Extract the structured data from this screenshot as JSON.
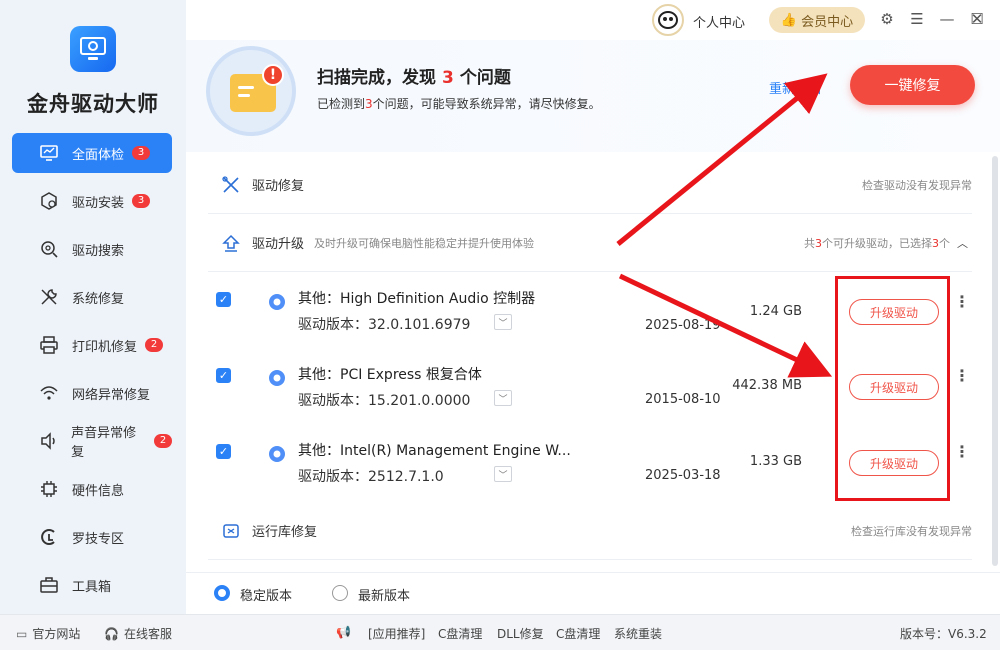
{
  "app": {
    "name": "金舟驱动大师"
  },
  "sidebar": {
    "items": [
      {
        "label": "全面体检",
        "badge": "3",
        "icon": "monitor-icon",
        "active": true
      },
      {
        "label": "驱动安装",
        "badge": "3",
        "icon": "box-gear-icon",
        "active": false
      },
      {
        "label": "驱动搜索",
        "badge": "",
        "icon": "gear-search-icon",
        "active": false
      },
      {
        "label": "系统修复",
        "badge": "",
        "icon": "wrench-icon",
        "active": false
      },
      {
        "label": "打印机修复",
        "badge": "2",
        "icon": "printer-icon",
        "active": false
      },
      {
        "label": "网络异常修复",
        "badge": "",
        "icon": "wifi-icon",
        "active": false
      },
      {
        "label": "声音异常修复",
        "badge": "2",
        "icon": "speaker-icon",
        "active": false
      },
      {
        "label": "硬件信息",
        "badge": "",
        "icon": "chip-icon",
        "active": false
      },
      {
        "label": "罗技专区",
        "badge": "",
        "icon": "logitech-icon",
        "active": false
      },
      {
        "label": "工具箱",
        "badge": "",
        "icon": "toolbox-icon",
        "active": false
      }
    ]
  },
  "topbar": {
    "user_center": "个人中心",
    "vip": "会员中心",
    "controls": [
      "settings-icon",
      "menu-icon",
      "minimize-icon",
      "maximize-icon",
      "close-icon"
    ]
  },
  "scan": {
    "title_prefix": "扫描完成，发现",
    "count": "3",
    "title_suffix": "个问题",
    "sub_prefix": "已检测到",
    "sub_count": "3",
    "sub_suffix": "个问题，可能导致系统异常，请尽快修复。",
    "rescan": "重新扫描",
    "fix_all": "一键修复"
  },
  "sections": {
    "repair": {
      "title": "驱动修复",
      "status": "检查驱动没有发现异常"
    },
    "upgrade": {
      "title": "驱动升级",
      "desc": "及时升级可确保电脑性能稳定并提升使用体验",
      "summary_prefix": "共",
      "summary_count": "3",
      "summary_mid": "个可升级驱动，已选择",
      "summary_sel": "3",
      "summary_suffix": "个"
    },
    "runtime": {
      "title": "运行库修复",
      "status": "检查运行库没有发现异常"
    }
  },
  "drivers": [
    {
      "name": "其他：High Definition Audio 控制器",
      "version": "驱动版本：32.0.101.6979",
      "date": "2025-08-19",
      "size": "1.24 GB",
      "action": "升级驱动"
    },
    {
      "name": "其他：PCI Express 根复合体",
      "version": "驱动版本：15.201.0.0000",
      "date": "2015-08-10",
      "size": "442.38 MB",
      "action": "升级驱动"
    },
    {
      "name": "其他：Intel(R) Management Engine W...",
      "version": "驱动版本：2512.7.1.0",
      "date": "2025-03-18",
      "size": "1.33 GB",
      "action": "升级驱动"
    }
  ],
  "version_choice": {
    "stable": "稳定版本",
    "latest": "最新版本",
    "selected": "stable"
  },
  "footer": {
    "website": "官方网站",
    "service": "在线客服",
    "links": [
      "[应用推荐]",
      "C盘清理",
      "DLL修复",
      "C盘清理",
      "系统重装"
    ],
    "version": "版本号：V6.3.2"
  },
  "colors": {
    "accent": "#2b82f7",
    "danger": "#f24a3f",
    "highlight": "#e8161b"
  }
}
